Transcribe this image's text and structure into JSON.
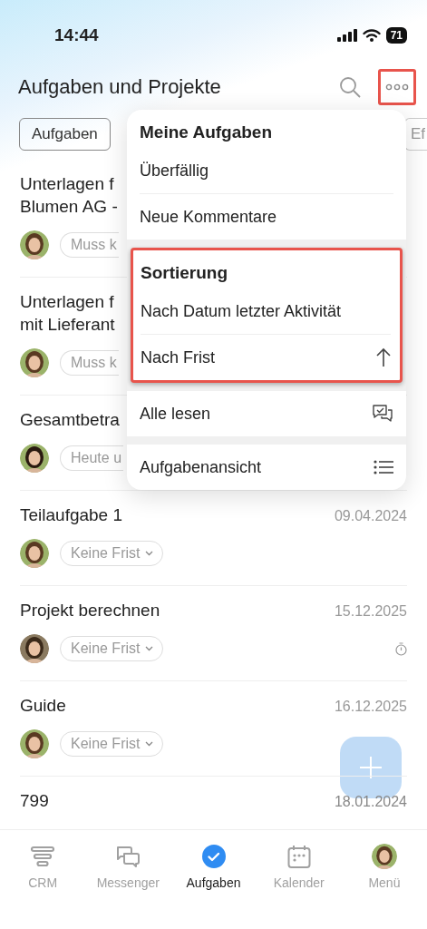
{
  "status_bar": {
    "time": "14:44",
    "battery": "71"
  },
  "header": {
    "title": "Aufgaben und Projekte",
    "more_highlighted": true
  },
  "filters": [
    {
      "label": "Aufgaben",
      "selected": true
    },
    {
      "label": "Ef",
      "selected": false
    }
  ],
  "tasks": [
    {
      "title": "Unterlagen f\nBlumen AG -",
      "deadline": "Muss k",
      "chevron": false,
      "timer": false
    },
    {
      "title": "Unterlagen f\nmit Lieferant",
      "deadline": "Muss k",
      "chevron": false,
      "timer": false
    },
    {
      "title": "Gesamtbetra",
      "deadline": "Heute u",
      "chevron": false,
      "timer": false
    },
    {
      "title": "Teilaufgabe 1",
      "date": "09.04.2024",
      "deadline": "Keine Frist",
      "chevron": true,
      "timer": false
    },
    {
      "title": "Projekt berechnen",
      "date": "15.12.2025",
      "deadline": "Keine Frist",
      "chevron": true,
      "timer": true
    },
    {
      "title": "Guide",
      "date": "16.12.2025",
      "deadline": "Keine Frist",
      "chevron": true,
      "timer": false
    },
    {
      "title": "799",
      "date": "18.01.2024"
    }
  ],
  "menu": {
    "sections": [
      {
        "title": "Meine Aufgaben",
        "highlighted": false,
        "items": [
          {
            "label": "Überfällig",
            "kind": "plain"
          },
          {
            "label": "Neue Kommentare",
            "kind": "plain"
          }
        ]
      },
      {
        "title": "Sortierung",
        "highlighted": true,
        "items": [
          {
            "label": "Nach Datum letzter Aktivität",
            "kind": "plain"
          },
          {
            "label": "Nach Frist",
            "kind": "sort"
          }
        ]
      },
      {
        "highlighted": false,
        "items": [
          {
            "label": "Alle lesen",
            "kind": "read"
          }
        ]
      },
      {
        "highlighted": false,
        "items": [
          {
            "label": "Aufgabenansicht",
            "kind": "view"
          }
        ]
      }
    ]
  },
  "tab_bar": [
    {
      "label": "CRM",
      "selected": false
    },
    {
      "label": "Messenger",
      "selected": false
    },
    {
      "label": "Aufgaben",
      "selected": true
    },
    {
      "label": "Kalender",
      "selected": false
    },
    {
      "label": "Menü",
      "selected": false
    }
  ]
}
